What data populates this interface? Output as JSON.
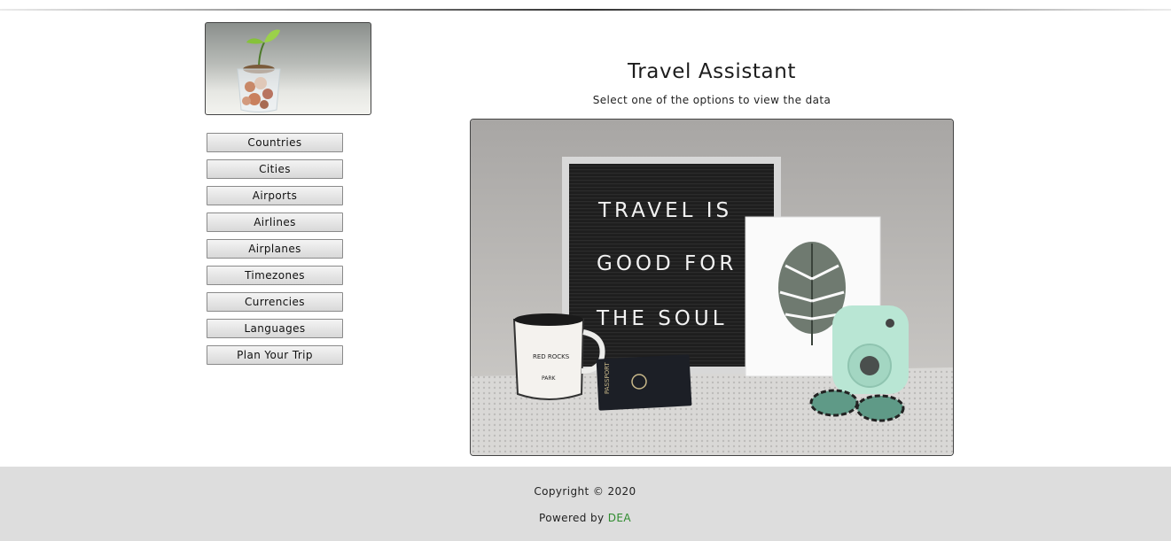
{
  "header": {
    "title": "Travel Assistant",
    "subtitle": "Select one of the options to view the data"
  },
  "sidebar": {
    "logo_icon": "plant-in-coin-jar",
    "items": [
      {
        "label": "Countries"
      },
      {
        "label": "Cities"
      },
      {
        "label": "Airports"
      },
      {
        "label": "Airlines"
      },
      {
        "label": "Airplanes"
      },
      {
        "label": "Timezones"
      },
      {
        "label": "Currencies"
      },
      {
        "label": "Languages"
      },
      {
        "label": "Plan Your Trip"
      }
    ]
  },
  "hero": {
    "board_lines": [
      "TRAVEL IS",
      "GOOD FOR",
      "THE SOUL"
    ],
    "mug_text": [
      "RED ROCKS",
      "PARK"
    ],
    "passport_text": "PASSPORT"
  },
  "footer": {
    "copyright": "Copyright © 2020",
    "powered_prefix": "Powered by ",
    "powered_brand": "DEA",
    "brand_color": "#2e8b2e"
  }
}
